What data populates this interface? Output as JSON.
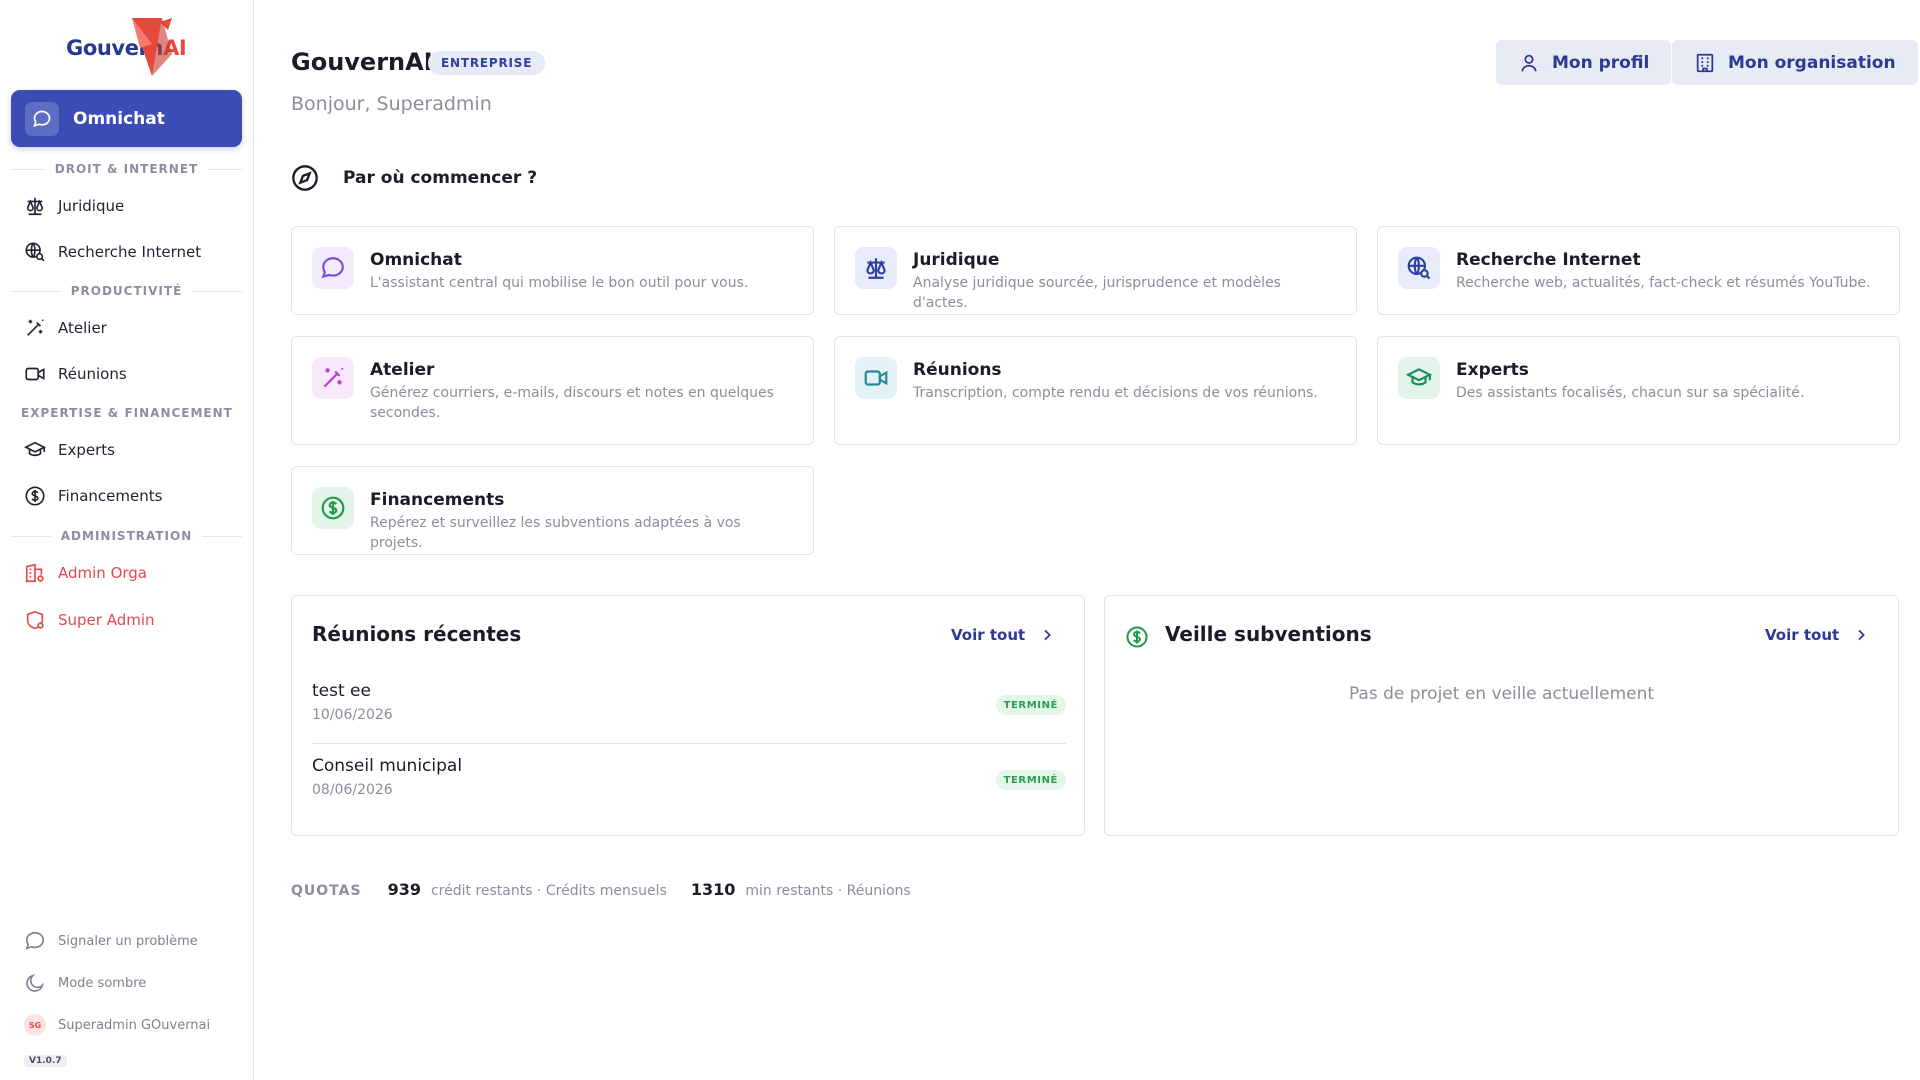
{
  "brand": {
    "logo_text_main": "Gouvern",
    "logo_text_ai": "AI",
    "accent": "#3b4db5",
    "logo_red": "#e8473d"
  },
  "sidebar": {
    "primary": {
      "label": "Omnichat",
      "icon": "chat-bubble-icon"
    },
    "sections": [
      {
        "title": "DROIT & INTERNET",
        "items": [
          {
            "label": "Juridique",
            "icon": "scale-icon"
          },
          {
            "label": "Recherche Internet",
            "icon": "globe-search-icon"
          }
        ]
      },
      {
        "title": "PRODUCTIVITÉ",
        "items": [
          {
            "label": "Atelier",
            "icon": "magic-wand-icon"
          },
          {
            "label": "Réunions",
            "icon": "video-camera-icon"
          }
        ]
      },
      {
        "title": "EXPERTISE & FINANCEMENT",
        "items": [
          {
            "label": "Experts",
            "icon": "graduation-cap-icon"
          },
          {
            "label": "Financements",
            "icon": "dollar-circle-icon"
          }
        ]
      },
      {
        "title": "ADMINISTRATION",
        "items": [
          {
            "label": "Admin Orga",
            "icon": "building-gear-icon"
          },
          {
            "label": "Super Admin",
            "icon": "shield-gear-icon"
          }
        ]
      }
    ],
    "footer": {
      "report": "Signaler un problème",
      "dark_mode": "Mode sombre",
      "user_initials": "SG",
      "user_name": "Superadmin GOuvernai",
      "version": "V1.0.7"
    }
  },
  "header": {
    "title": "GouvernAI",
    "plan_badge": "ENTREPRISE",
    "greeting": "Bonjour, Superadmin",
    "profile_button": "Mon profil",
    "org_button": "Mon organisation"
  },
  "start": {
    "title": "Par où commencer ?"
  },
  "tools": [
    {
      "title": "Omnichat",
      "desc": "L'assistant central qui mobilise le bon outil pour vous.",
      "icon": "chat-bubble-icon",
      "color": "#7c4ddb",
      "bg": "#f1ebfc"
    },
    {
      "title": "Juridique",
      "desc": "Analyse juridique sourcée, jurisprudence et modèles d'actes.",
      "icon": "scale-icon",
      "color": "#3040a0",
      "bg": "#e8ecf8"
    },
    {
      "title": "Recherche Internet",
      "desc": "Recherche web, actualités, fact-check et résumés YouTube.",
      "icon": "globe-search-icon",
      "color": "#3040a0",
      "bg": "#e8ecf8"
    },
    {
      "title": "Atelier",
      "desc": "Générez courriers, e-mails, discours et notes en quelques secondes.",
      "icon": "magic-wand-icon",
      "color": "#b03ec7",
      "bg": "#f7e9fb"
    },
    {
      "title": "Réunions",
      "desc": "Transcription, compte rendu et décisions de vos réunions.",
      "icon": "video-camera-icon",
      "color": "#1f8a9a",
      "bg": "#e3f3f5"
    },
    {
      "title": "Experts",
      "desc": "Des assistants focalisés, chacun sur sa spécialité.",
      "icon": "graduation-cap-icon",
      "color": "#1b8c5a",
      "bg": "#e2f4ea"
    },
    {
      "title": "Financements",
      "desc": "Repérez et surveillez les subventions adaptées à vos projets.",
      "icon": "dollar-circle-icon",
      "color": "#1f9a4a",
      "bg": "#e3f5e9"
    }
  ],
  "meetings_panel": {
    "title": "Réunions récentes",
    "see_all": "Voir tout",
    "rows": [
      {
        "name": "test ee",
        "date": "10/06/2026",
        "status": "TERMINÉ"
      },
      {
        "name": "Conseil municipal",
        "date": "08/06/2026",
        "status": "TERMINÉ"
      }
    ]
  },
  "grants_panel": {
    "title": "Veille subventions",
    "see_all": "Voir tout",
    "empty": "Pas de projet en veille actuellement"
  },
  "quotas": {
    "label": "QUOTAS",
    "credits_value": "939",
    "credits_text": "crédit restants · Crédits mensuels",
    "minutes_value": "1310",
    "minutes_text": "min restants · Réunions"
  }
}
